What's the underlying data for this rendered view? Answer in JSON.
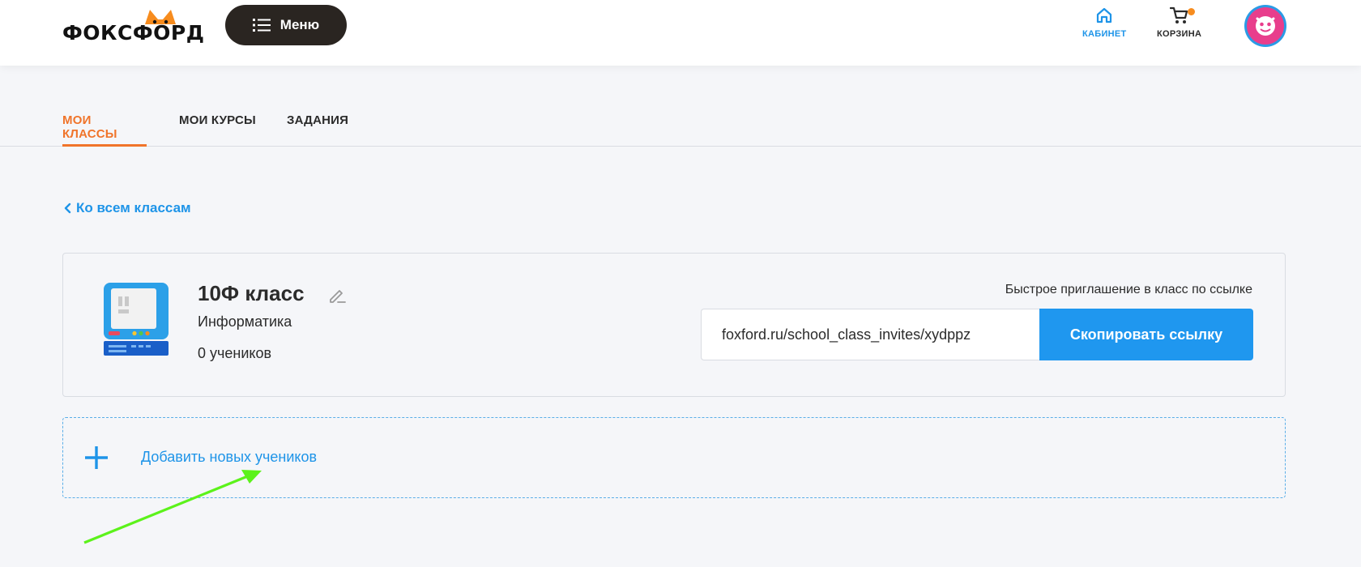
{
  "header": {
    "logo_text": "ФОКСФОРД",
    "menu_label": "Меню",
    "nav": [
      {
        "label": "КАБИНЕТ",
        "icon": "home-icon",
        "color": "#1e94e8"
      },
      {
        "label": "КОРЗИНА",
        "icon": "cart-icon"
      }
    ]
  },
  "tabs": [
    {
      "label": "МОИ КЛАССЫ",
      "active": true
    },
    {
      "label": "МОИ КУРСЫ",
      "active": false
    },
    {
      "label": "ЗАДАНИЯ",
      "active": false
    }
  ],
  "back_link": "Ко всем классам",
  "class_card": {
    "title": "10Ф класс",
    "subject": "Информатика",
    "students": "0 учеников",
    "invite_label": "Быстрое приглашение в класс по ссылке",
    "invite_link": "foxford.ru/school_class_invites/xydppz",
    "copy_button": "Скопировать ссылку"
  },
  "add_students": "Добавить новых учеников",
  "colors": {
    "accent_blue": "#1f97ef",
    "accent_orange": "#f0742a",
    "annotation_green": "#5cf21b"
  }
}
